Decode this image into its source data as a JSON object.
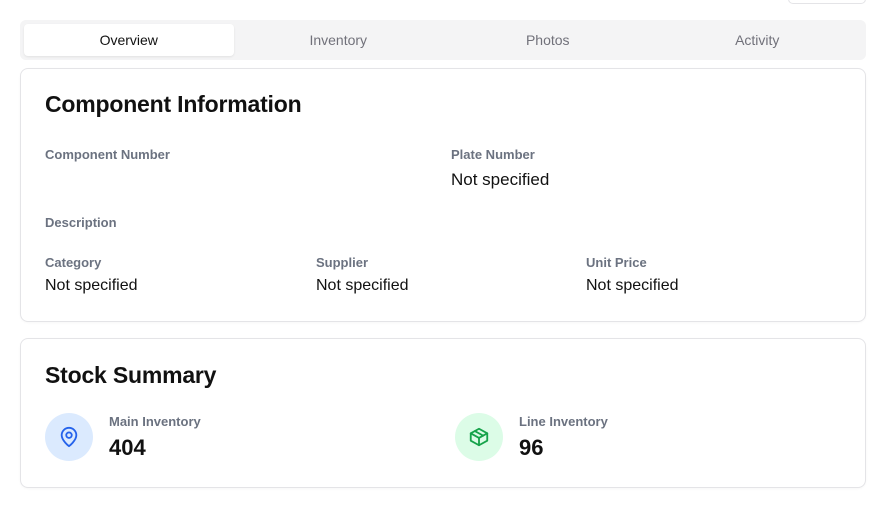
{
  "tabs": [
    {
      "label": "Overview",
      "active": true
    },
    {
      "label": "Inventory",
      "active": false
    },
    {
      "label": "Photos",
      "active": false
    },
    {
      "label": "Activity",
      "active": false
    }
  ],
  "component_info": {
    "title": "Component Information",
    "component_number": {
      "label": "Component Number",
      "value": ""
    },
    "plate_number": {
      "label": "Plate Number",
      "value": "Not specified"
    },
    "description": {
      "label": "Description",
      "value": ""
    },
    "category": {
      "label": "Category",
      "value": "Not specified"
    },
    "supplier": {
      "label": "Supplier",
      "value": "Not specified"
    },
    "unit_price": {
      "label": "Unit Price",
      "value": "Not specified"
    }
  },
  "stock_summary": {
    "title": "Stock Summary",
    "main_inventory": {
      "label": "Main Inventory",
      "value": "404",
      "icon": "map-pin-icon",
      "color": "#2563eb"
    },
    "line_inventory": {
      "label": "Line Inventory",
      "value": "96",
      "icon": "package-icon",
      "color": "#16a34a"
    }
  }
}
